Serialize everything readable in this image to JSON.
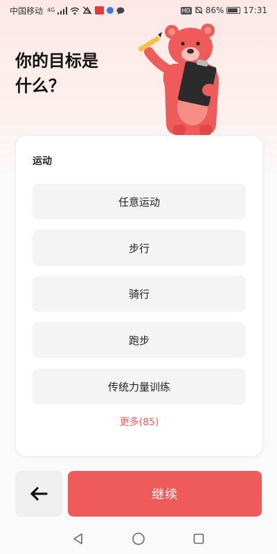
{
  "status_bar": {
    "carrier": "中国移动",
    "network": "4G",
    "battery": "86%",
    "battery_level": 0.86,
    "time": "17:31",
    "hd_label": "HD"
  },
  "heading": {
    "line1": "你的目标是",
    "line2": "什么？"
  },
  "illustration": {
    "icon": "bear-with-clipboard",
    "colors": {
      "bear": "#ef5b5b",
      "bear_light": "#f58f86",
      "clipboard": "#2b2b2b"
    }
  },
  "card": {
    "section_label": "运动",
    "options": [
      {
        "label": "任意运动"
      },
      {
        "label": "步行"
      },
      {
        "label": "骑行"
      },
      {
        "label": "跑步"
      },
      {
        "label": "传统力量训练"
      }
    ],
    "more_link": "更多(85)"
  },
  "footer": {
    "back_icon": "arrow-left-icon",
    "continue_label": "继续"
  },
  "colors": {
    "accent": "#ef5b5b",
    "option_bg": "#f4f4f4"
  },
  "nav_bar": {
    "icons": [
      "back-triangle-icon",
      "home-circle-icon",
      "recents-square-icon"
    ]
  }
}
